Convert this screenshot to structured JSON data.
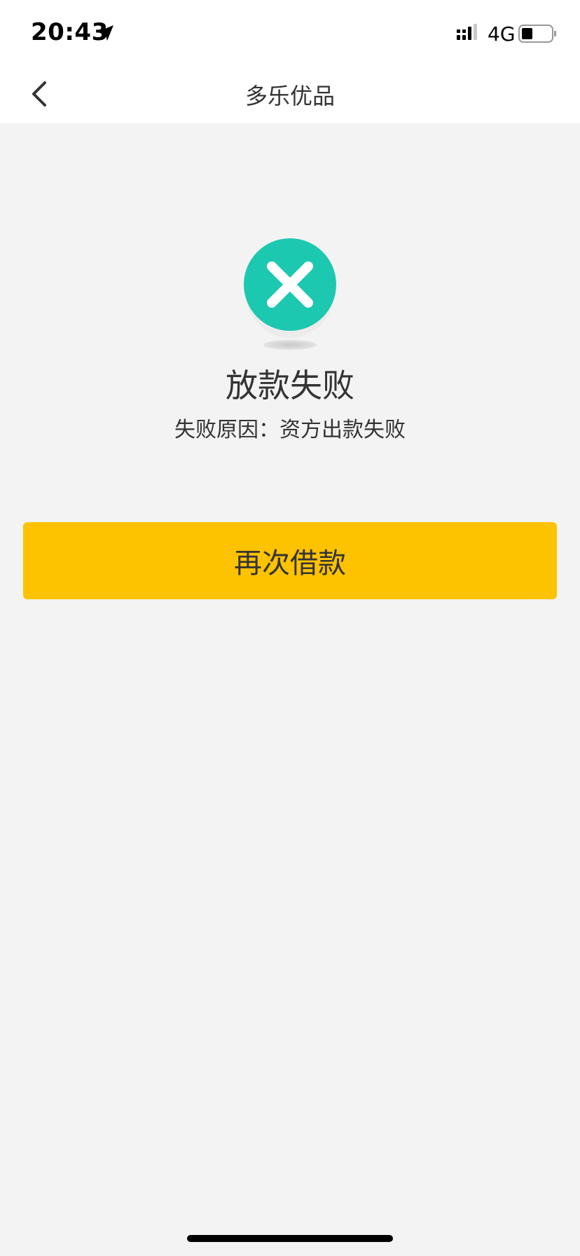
{
  "status_bar": {
    "time": "20:43",
    "network": "4G",
    "icons": [
      "location-arrow-icon",
      "signal-icon",
      "battery-icon"
    ]
  },
  "nav": {
    "back_icon": "chevron-left-icon",
    "title": "多乐优品"
  },
  "result": {
    "icon": "error-x-icon",
    "title": "放款失败",
    "reason": "失败原因：资方出款失败"
  },
  "actions": {
    "retry_label": "再次借款"
  },
  "colors": {
    "accent_button": "#fdc200",
    "error_icon": "#1cc8b0",
    "background": "#f3f3f3"
  }
}
